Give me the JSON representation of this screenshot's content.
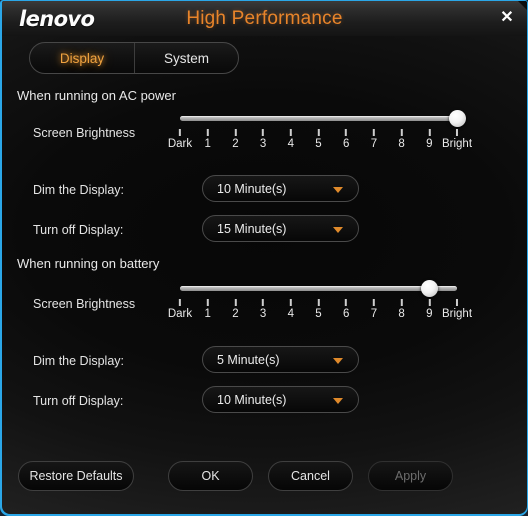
{
  "window": {
    "brand": "lenovo",
    "title": "High Performance",
    "close_label": "✕",
    "accent_orange": "#e8842a",
    "border_blue": "#2ba7e8"
  },
  "tabs": [
    {
      "label": "Display",
      "active": true
    },
    {
      "label": "System",
      "active": false
    }
  ],
  "sections": [
    {
      "title": "When running on AC power",
      "brightness": {
        "label": "Screen Brightness",
        "ticks": [
          "Dark",
          "1",
          "2",
          "3",
          "4",
          "5",
          "6",
          "7",
          "8",
          "9",
          "Bright"
        ],
        "value_index": 10,
        "value_label": "Bright"
      },
      "fields": [
        {
          "label": "Dim the Display:",
          "value": "10 Minute(s)"
        },
        {
          "label": "Turn off Display:",
          "value": "15 Minute(s)"
        }
      ]
    },
    {
      "title": "When running on battery",
      "brightness": {
        "label": "Screen Brightness",
        "ticks": [
          "Dark",
          "1",
          "2",
          "3",
          "4",
          "5",
          "6",
          "7",
          "8",
          "9",
          "Bright"
        ],
        "value_index": 9,
        "value_label": "9"
      },
      "fields": [
        {
          "label": "Dim the Display:",
          "value": "5 Minute(s)"
        },
        {
          "label": "Turn off Display:",
          "value": "10 Minute(s)"
        }
      ]
    }
  ],
  "footer": {
    "restore": "Restore Defaults",
    "ok": "OK",
    "cancel": "Cancel",
    "apply": "Apply",
    "apply_disabled": true
  }
}
